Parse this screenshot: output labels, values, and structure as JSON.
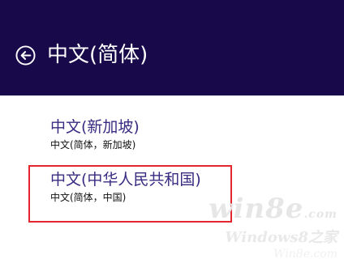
{
  "header": {
    "title": "中文(简体)",
    "back_icon": "back-arrow-circle-icon",
    "background": "#180a4a"
  },
  "options": [
    {
      "title": "中文(新加坡)",
      "subtitle": "中文(简体，新加坡)"
    },
    {
      "title": "中文(中华人民共和国)",
      "subtitle": "中文(简体，中国)",
      "highlighted": true
    }
  ],
  "colors": {
    "accent_text": "#3a2b82",
    "highlight_border": "#e3262f"
  },
  "watermark": {
    "line1": "win8e",
    "line1_suffix": ".com",
    "line2": "Windows8之家",
    "line3": "Win8e.com"
  }
}
